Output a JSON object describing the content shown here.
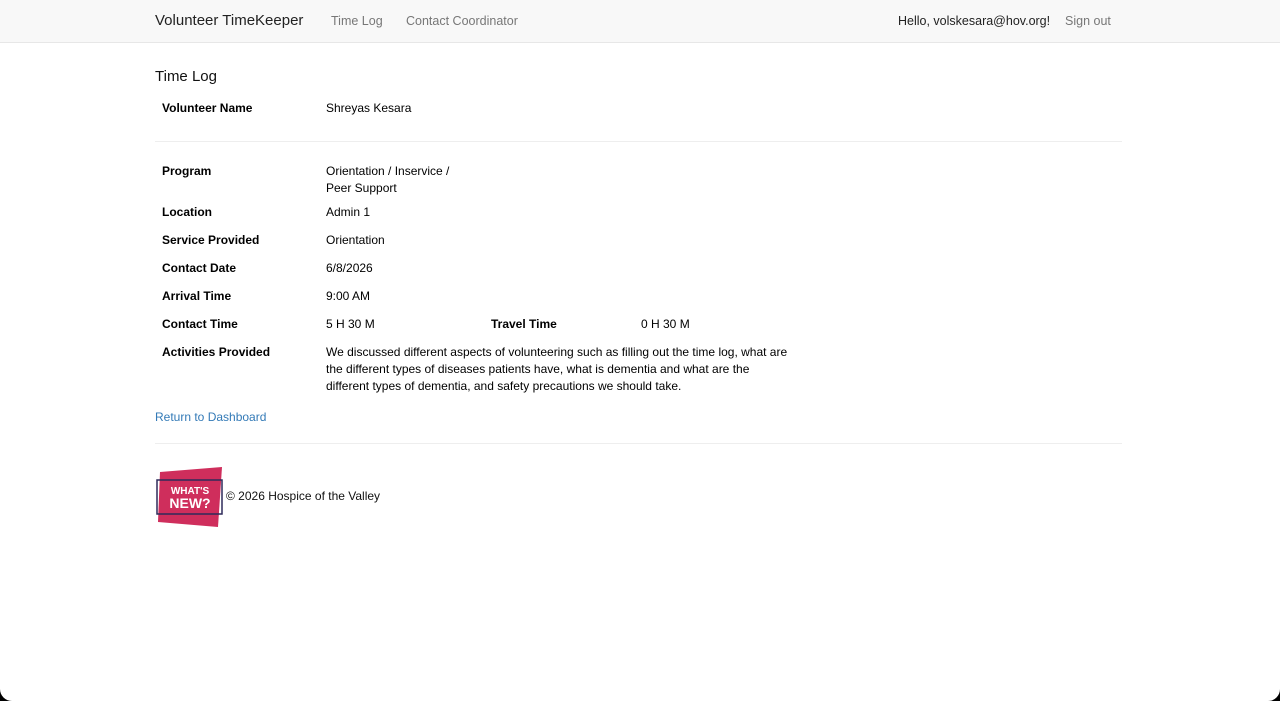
{
  "navbar": {
    "brand": "Volunteer TimeKeeper",
    "links": [
      "Time Log",
      "Contact Coordinator"
    ],
    "greeting": "Hello, volskesara@hov.org!",
    "sign_out": "Sign out"
  },
  "page": {
    "title": "Time Log",
    "volunteer_name_label": "Volunteer Name",
    "volunteer_name": "Shreyas Kesara"
  },
  "details": {
    "program_label": "Program",
    "program_line1": "Orientation / Inservice /",
    "program_line2": "Peer Support",
    "location_label": "Location",
    "location": "Admin 1",
    "service_label": "Service Provided",
    "service": "Orientation",
    "contact_date_label": "Contact Date",
    "contact_date": "6/8/2026",
    "arrival_label": "Arrival Time",
    "arrival": "9:00 AM",
    "contact_time_label": "Contact Time",
    "contact_time": "5 H 30 M",
    "travel_time_label": "Travel Time",
    "travel_time": "0 H 30 M",
    "activities_label": "Activities Provided",
    "activities_line1": "We discussed different aspects of volunteering such as filling out the time log, what are",
    "activities_line2": "the different types of diseases patients have, what is dementia and what are the",
    "activities_line3": "different types of dementia, and safety precautions we should take."
  },
  "actions": {
    "return_link": "Return to Dashboard"
  },
  "footer": {
    "logo_line1": "WHAT'S",
    "logo_line2": "NEW?",
    "copyright": "© 2026 Hospice of the Valley"
  },
  "colors": {
    "link": "#337ab7",
    "logo_pink": "#cf2e5c",
    "logo_outline": "#2e2a5a"
  }
}
